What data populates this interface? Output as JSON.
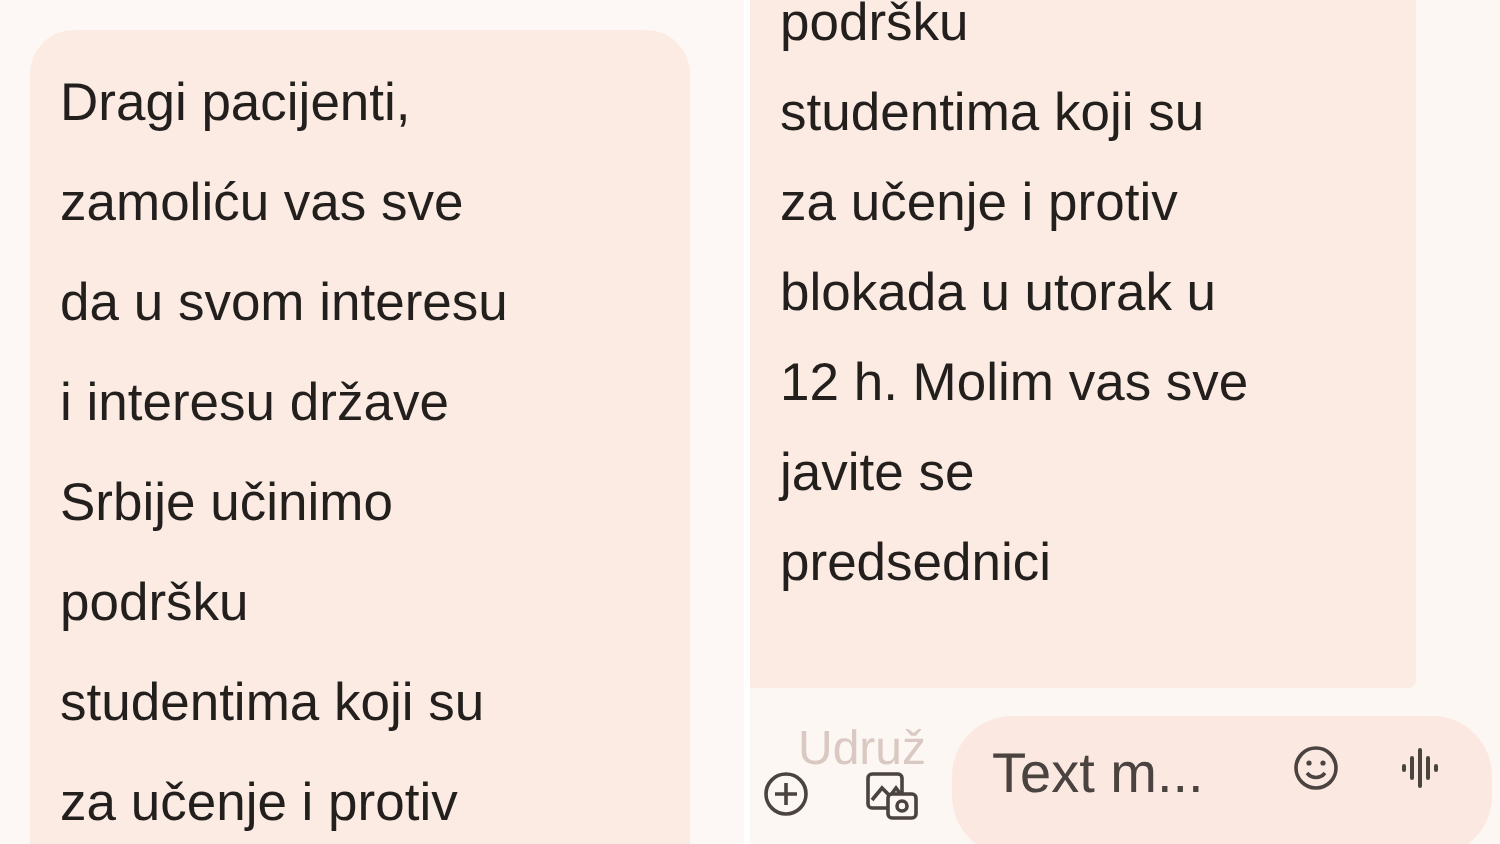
{
  "left_screen": {
    "message": {
      "text": "Dragi pacijenti,\nzamoliću vas sve\nda u svom interesu\ni interesu države\nSrbije učinimo\npodršku\nstudentima koji su\nza učenje i protiv"
    }
  },
  "right_screen": {
    "message": {
      "text": "podršku\nstudentima koji su\nza učenje i protiv\nblokada u utorak u\n12 h. Molim vas sve\njavite se\npredsednici"
    },
    "faded_message": {
      "text": "Udruž"
    },
    "compose": {
      "placeholder": "Text m..."
    }
  }
}
